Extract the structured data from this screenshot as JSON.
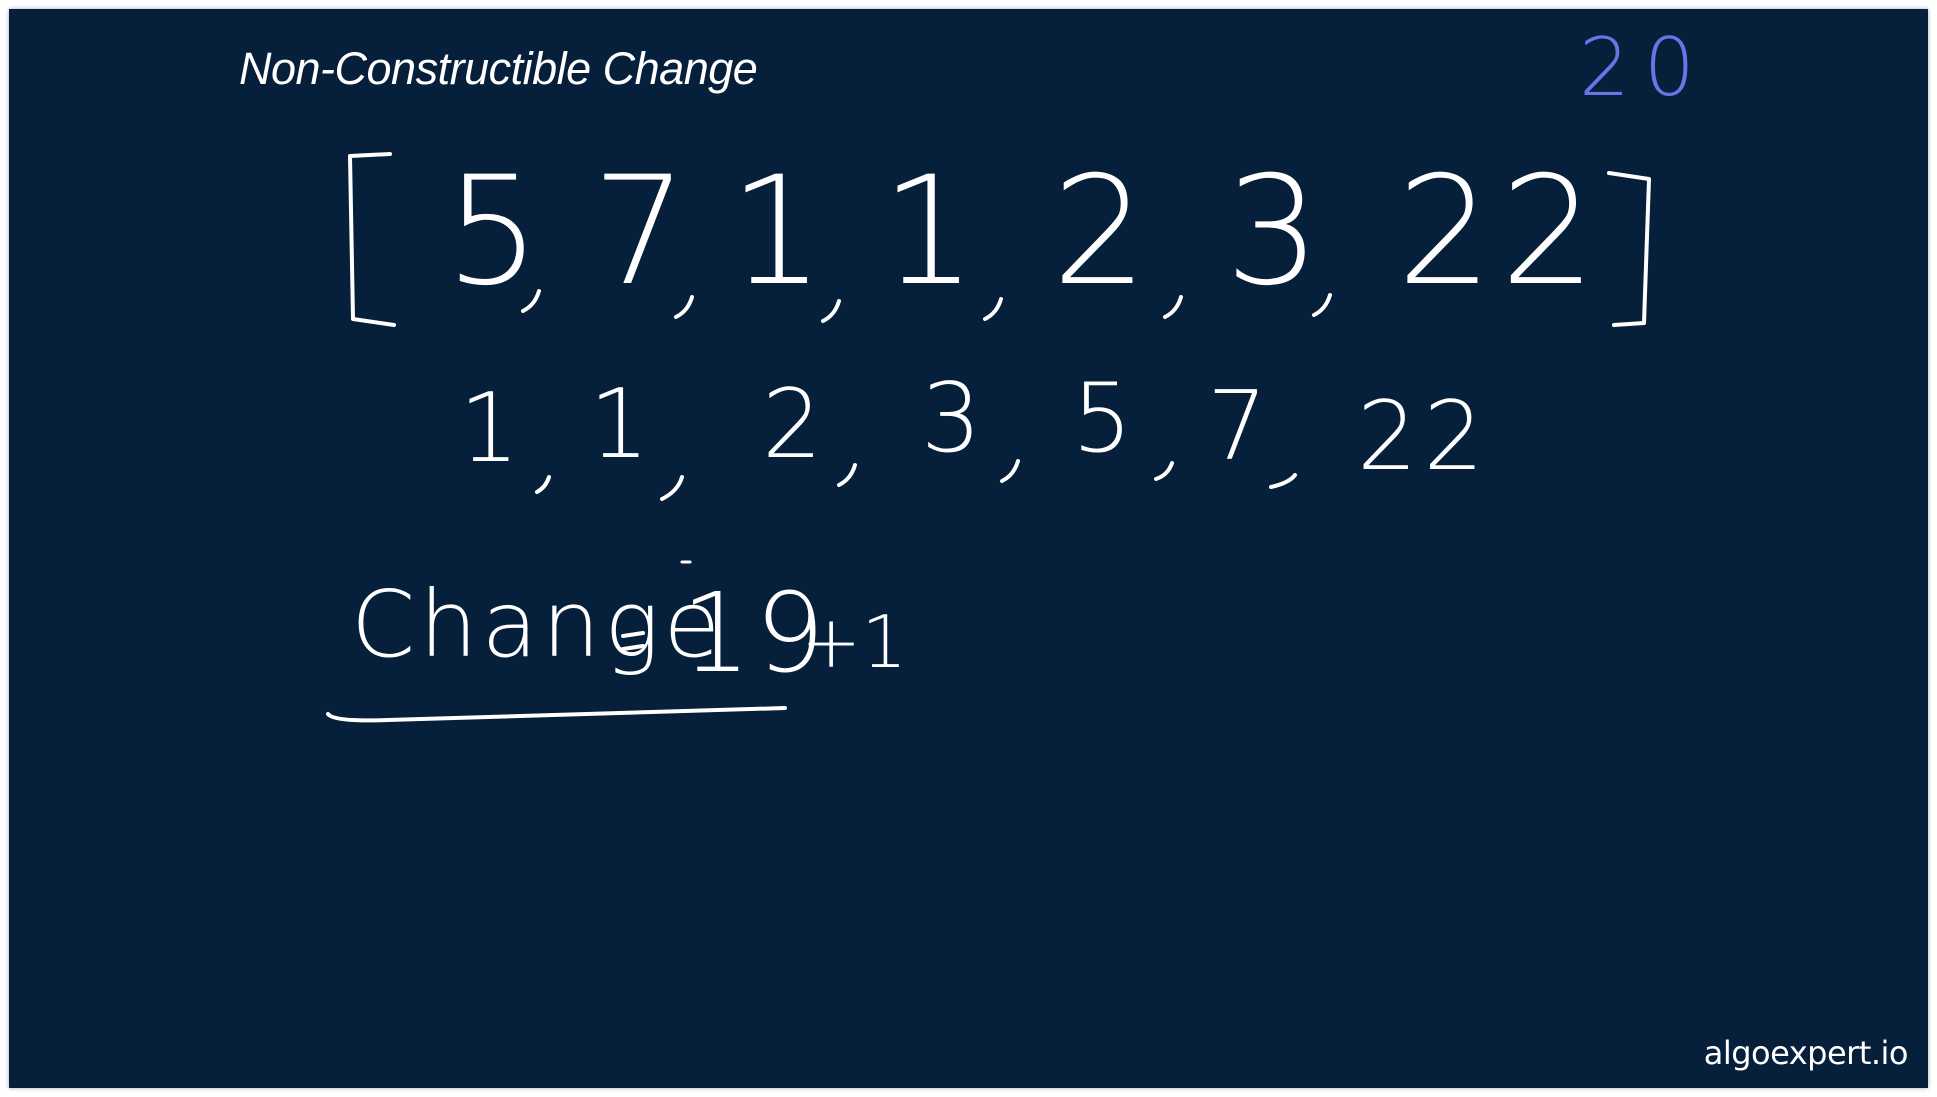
{
  "slide": {
    "title": "Non-Constructible Change",
    "brand": "algoexpert.io",
    "accent_color": "#6a74e8",
    "background_color": "#061f3a"
  },
  "annotations": {
    "corner_number": "20",
    "input_array": [
      "5",
      "7",
      "1",
      "1",
      "2",
      "3",
      "22"
    ],
    "sorted_array": [
      "1",
      "1",
      "2",
      "3",
      "5",
      "7",
      "22"
    ],
    "change_label": "Change",
    "change_value": "19",
    "change_increment": "+1"
  }
}
